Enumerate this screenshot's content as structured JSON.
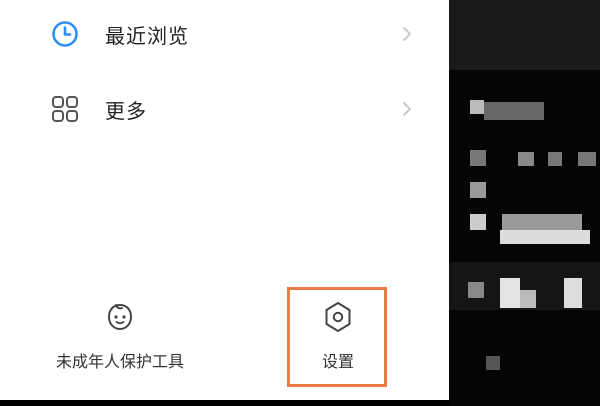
{
  "menu": {
    "items": [
      {
        "label": "最近浏览",
        "icon": "clock-icon"
      },
      {
        "label": "更多",
        "icon": "grid-icon"
      }
    ]
  },
  "bottom": {
    "minor_tool_label": "未成年人保护工具",
    "minor_tool_icon": "child-face-icon",
    "settings_label": "设置",
    "settings_icon": "hexagon-settings-icon"
  },
  "colors": {
    "accent_blue": "#2f8ff0",
    "highlight_orange": "#ee7a47",
    "text_primary": "#222222",
    "chevron_gray": "#c4c4c4"
  }
}
